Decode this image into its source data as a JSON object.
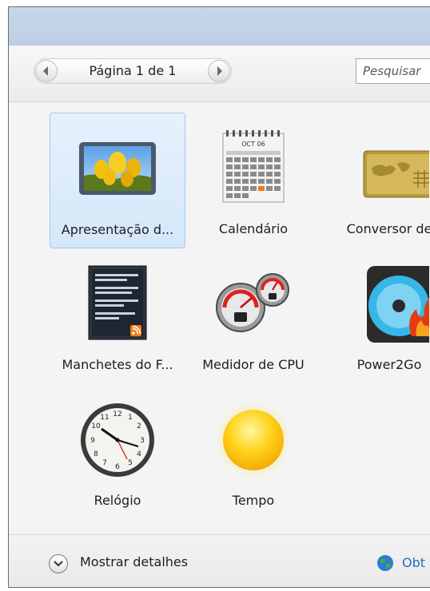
{
  "pager": {
    "label": "Página 1 de 1",
    "prev_icon": "chevron-left-icon",
    "next_icon": "chevron-right-icon"
  },
  "search": {
    "placeholder": "Pesquisar"
  },
  "gadgets": [
    {
      "label": "Apresentação d...",
      "icon": "slideshow-icon",
      "selected": true
    },
    {
      "label": "Calendário",
      "icon": "calendar-icon",
      "calendar_month": "OCT 06"
    },
    {
      "label": "Conversor de",
      "icon": "currency-converter-icon"
    },
    {
      "label": "Manchetes do F...",
      "icon": "feed-headlines-icon"
    },
    {
      "label": "Medidor de CPU",
      "icon": "cpu-meter-icon"
    },
    {
      "label": "Power2Go",
      "icon": "power2go-icon"
    },
    {
      "label": "Relógio",
      "icon": "clock-icon"
    },
    {
      "label": "Tempo",
      "icon": "weather-icon"
    }
  ],
  "footer": {
    "details_label": "Mostrar detalhes",
    "details_icon": "chevron-down-icon",
    "link_label": "Obt",
    "link_icon": "globe-icon"
  },
  "colors": {
    "selection_bg": "#d4e7fa",
    "selection_border": "#a6c8f0",
    "link": "#1f6fc1",
    "titlebar": "#c2d3ea"
  }
}
